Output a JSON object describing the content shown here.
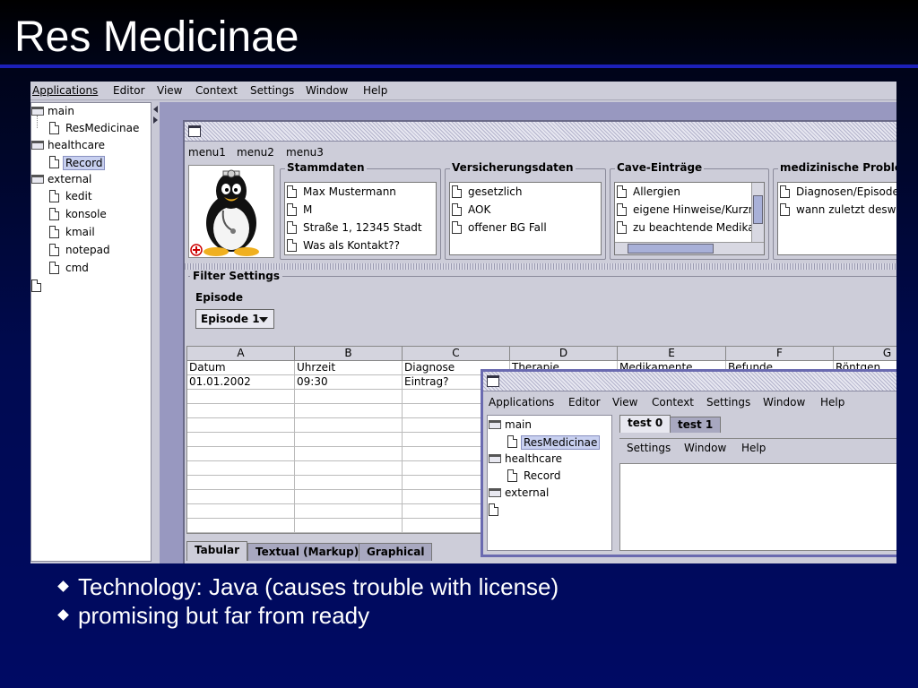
{
  "slide": {
    "title": "Res Medicinae",
    "bullets": [
      "Technology: Java (causes trouble with license)",
      "promising but far from ready"
    ]
  },
  "main_menu": [
    "Applications",
    "Editor",
    "View",
    "Context",
    "Settings",
    "Window",
    "Help"
  ],
  "tree": {
    "main": "main",
    "resmedicinae": "ResMedicinae",
    "healthcare": "healthcare",
    "record": "Record",
    "external": "external",
    "kedit": "kedit",
    "konsole": "konsole",
    "kmail": "kmail",
    "notepad": "notepad",
    "cmd": "cmd"
  },
  "record_window": {
    "menu": [
      "menu1",
      "menu2",
      "menu3"
    ],
    "stammdaten": {
      "title": "Stammdaten",
      "items": [
        "Max Mustermann",
        "M",
        "Straße 1, 12345 Stadt",
        "Was als Kontakt??"
      ]
    },
    "versicherung": {
      "title": "Versicherungsdaten",
      "items": [
        "gesetzlich",
        "AOK",
        "offener BG Fall"
      ]
    },
    "cave": {
      "title": "Cave-Einträge",
      "items": [
        "Allergien",
        "eigene Hinweise/Kurzn",
        "zu beachtende Medikat"
      ]
    },
    "probleme": {
      "title": "medizinische Probleme",
      "items": [
        "Diagnosen/Episoden",
        "wann zuletzt desw"
      ]
    },
    "filter": {
      "title": "Filter Settings",
      "episode_label": "Episode",
      "episode_value": "Episode 1"
    },
    "table": {
      "columns": [
        "A",
        "B",
        "C",
        "D",
        "E",
        "F",
        "G"
      ],
      "header_row": [
        "Datum",
        "Uhrzeit",
        "Diagnose",
        "Therapie",
        "Medikamente",
        "Befunde",
        "Röntgen"
      ],
      "row1": [
        "01.01.2002",
        "09:30",
        "Eintrag?"
      ]
    },
    "tabs": [
      "Tabular",
      "Textual (Markup)",
      "Graphical"
    ]
  },
  "second_window": {
    "menu": [
      "Applications",
      "Editor",
      "View",
      "Context",
      "Settings",
      "Window",
      "Help"
    ],
    "tree": {
      "main": "main",
      "resmedicinae": "ResMedicinae",
      "healthcare": "healthcare",
      "record": "Record",
      "external": "external"
    },
    "tabs": [
      "test 0",
      "test 1"
    ],
    "inner_menu": [
      "Settings",
      "Window",
      "Help"
    ]
  },
  "colors": {
    "title_rule": "#1c20b8",
    "desktop": "#9898c0",
    "panel": "#cdcdd9"
  }
}
